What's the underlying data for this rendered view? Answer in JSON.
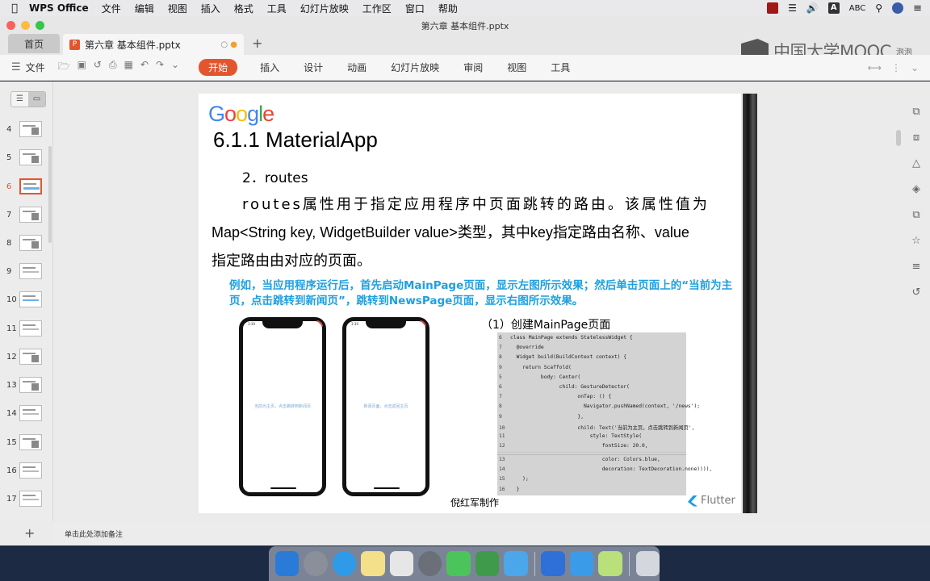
{
  "menubar": {
    "apple": "",
    "app_name": "WPS Office",
    "items": [
      "文件",
      "编辑",
      "视图",
      "插入",
      "格式",
      "工具",
      "幻灯片放映",
      "工作区",
      "窗口",
      "帮助"
    ],
    "input_method": "ABC"
  },
  "window": {
    "title": "第六章 基本组件.pptx",
    "home_tab": "首页",
    "doc_tab": "第六章 基本组件.pptx",
    "new_tab": "+",
    "watermark": "中国大学MOOC",
    "user": "泡泡"
  },
  "ribbon": {
    "file_menu": "文件",
    "tabs": [
      "开始",
      "插入",
      "设计",
      "动画",
      "幻灯片放映",
      "审阅",
      "视图",
      "工具"
    ],
    "active_tab": "开始"
  },
  "thumbnails": {
    "numbers": [
      "4",
      "5",
      "6",
      "7",
      "8",
      "9",
      "10",
      "11",
      "12",
      "13",
      "14",
      "15",
      "16",
      "17"
    ],
    "selected": "6",
    "add_label": "+",
    "notes_placeholder": "单击此处添加备注"
  },
  "slide": {
    "logo": "Google",
    "title": "6.1.1 MaterialApp",
    "subheading": "2．routes",
    "paragraph_line1": "routes属性用于指定应用程序中页面跳转的路由。该属性值为",
    "paragraph_line2": "Map<String key, WidgetBuilder value>类型，其中key指定路由名称、value",
    "paragraph_line3": "指定路由由对应的页面。",
    "example": "例如，当应用程序运行后，首先启动MainPage页面，显示左图所示效果；然后单击页面上的“当前为主页，点击跳转到新闻页”，跳转到NewsPage页面，显示右图所示效果。",
    "phone_left_label": "当前为主页，点击跳转到新闻页",
    "phone_right_label": "新闻页面，点击返回主页",
    "phone_time": "3:30",
    "code_title": "（1）创建MainPage页面",
    "code_lines": [
      {
        "n": "6",
        "code": "class MainPage extends StatelessWidget {"
      },
      {
        "n": "7",
        "code": "  @override"
      },
      {
        "n": "8",
        "code": "  Widget build(BuildContext context) {"
      },
      {
        "n": "9",
        "code": "    return Scaffold("
      },
      {
        "n": "5",
        "code": "          body: Center("
      },
      {
        "n": "6",
        "code": "                child: GestureDetector("
      },
      {
        "n": "7",
        "code": "                      onTap: () {"
      },
      {
        "n": "8",
        "code": "                        Navigator.pushNamed(context, '/news');"
      },
      {
        "n": "9",
        "code": "                      },"
      },
      {
        "n": "10",
        "code": "                      child: Text('当前为主页，点击跳转到新闻页',"
      },
      {
        "n": "11",
        "code": "                          style: TextStyle("
      },
      {
        "n": "12",
        "code": "                              fontSize: 20.0,"
      },
      {
        "n": "13",
        "code": "                              color: Colors.blue,"
      },
      {
        "n": "14",
        "code": "                              decoration: TextDecoration.none)))),"
      },
      {
        "n": "15",
        "code": "    );"
      },
      {
        "n": "16",
        "code": "  }"
      }
    ],
    "author": "倪红军制作",
    "flutter": "Flutter"
  },
  "colors": {
    "accent": "#e3552f",
    "example_text": "#1ea0e0"
  }
}
